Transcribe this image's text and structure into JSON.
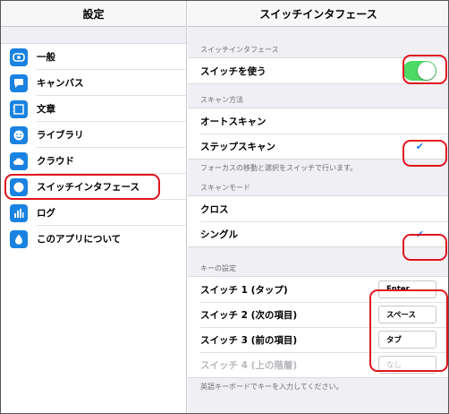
{
  "sidebar": {
    "title": "設定",
    "items": [
      {
        "label": "一般",
        "icon": "gear-icon"
      },
      {
        "label": "キャンバス",
        "icon": "canvas-icon"
      },
      {
        "label": "文章",
        "icon": "document-icon"
      },
      {
        "label": "ライブラリ",
        "icon": "library-icon"
      },
      {
        "label": "クラウド",
        "icon": "cloud-icon"
      },
      {
        "label": "スイッチインタフェース",
        "icon": "switch-icon"
      },
      {
        "label": "ログ",
        "icon": "chart-icon"
      },
      {
        "label": "このアプリについて",
        "icon": "drop-icon"
      }
    ],
    "selected_index": 5
  },
  "detail": {
    "title": "スイッチインタフェース",
    "switch_section": {
      "header": "スイッチインタフェース",
      "use_switch_label": "スイッチを使う",
      "use_switch_on": true
    },
    "scan_method": {
      "header": "スキャン方法",
      "options": [
        "オートスキャン",
        "ステップスキャン"
      ],
      "selected_index": 1,
      "footer": "フォーカスの移動と選択をスイッチで行います。"
    },
    "scan_mode": {
      "header": "スキャンモード",
      "options": [
        "クロス",
        "シングル"
      ],
      "selected_index": 1
    },
    "key_settings": {
      "header": "キーの設定",
      "rows": [
        {
          "label": "スイッチ 1 (タップ)",
          "key": "Enter"
        },
        {
          "label": "スイッチ 2 (次の項目)",
          "key": "スペース"
        },
        {
          "label": "スイッチ 3 (前の項目)",
          "key": "タブ"
        },
        {
          "label": "スイッチ 4 (上の階層)",
          "key": "なし",
          "disabled": true
        }
      ],
      "footer": "英語キーボードでキーを入力してください。"
    }
  },
  "colors": {
    "accent": "#1a82e0",
    "toggle_on": "#4cd964",
    "check": "#1a7cf2",
    "annotation": "#e0141e"
  }
}
